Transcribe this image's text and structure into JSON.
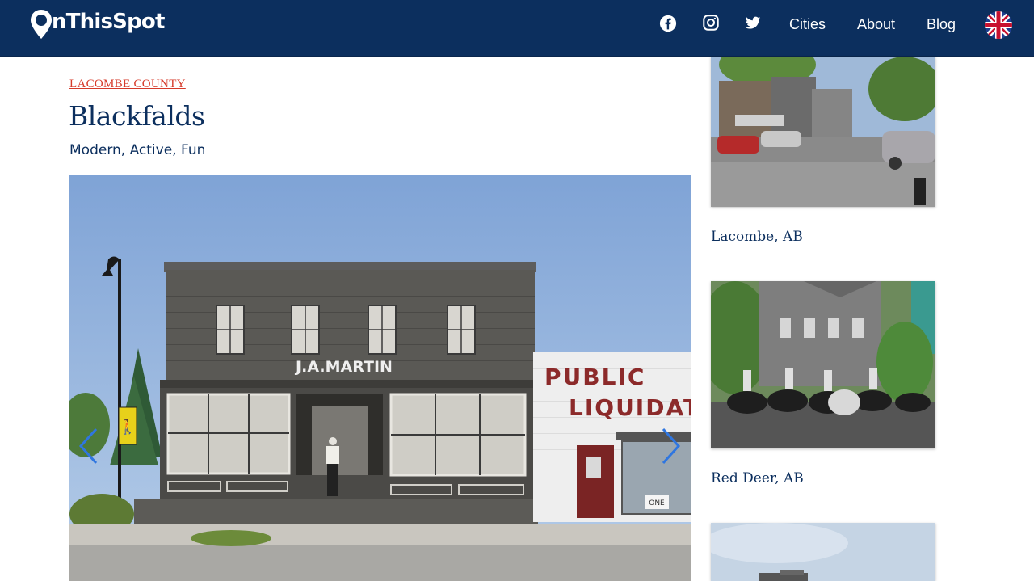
{
  "header": {
    "logo_text": "nThisSpot",
    "nav": {
      "cities": "Cities",
      "about": "About",
      "blog": "Blog"
    },
    "icons": [
      "map-pin-icon",
      "facebook-icon",
      "instagram-icon",
      "twitter-icon",
      "uk-flag-icon"
    ],
    "background_color": "#0c2f5e"
  },
  "main": {
    "breadcrumb": "LACOMBE COUNTY",
    "title": "Blackfalds",
    "subtitle": "Modern, Active, Fun",
    "carousel": {
      "signs": {
        "store": "J.A.MARTIN",
        "neighbor_line1": "PUBLIC",
        "neighbor_line2": "LIQUIDAT",
        "door_sign": "ONE"
      }
    }
  },
  "sidebar": {
    "cards": [
      {
        "title": "Lacombe, AB"
      },
      {
        "title": "Red Deer, AB"
      },
      {
        "title": ""
      }
    ]
  },
  "colors": {
    "navy": "#0c2f5e",
    "breadcrumb_red": "#d63a2a",
    "arrow_blue": "#2f76e0"
  }
}
